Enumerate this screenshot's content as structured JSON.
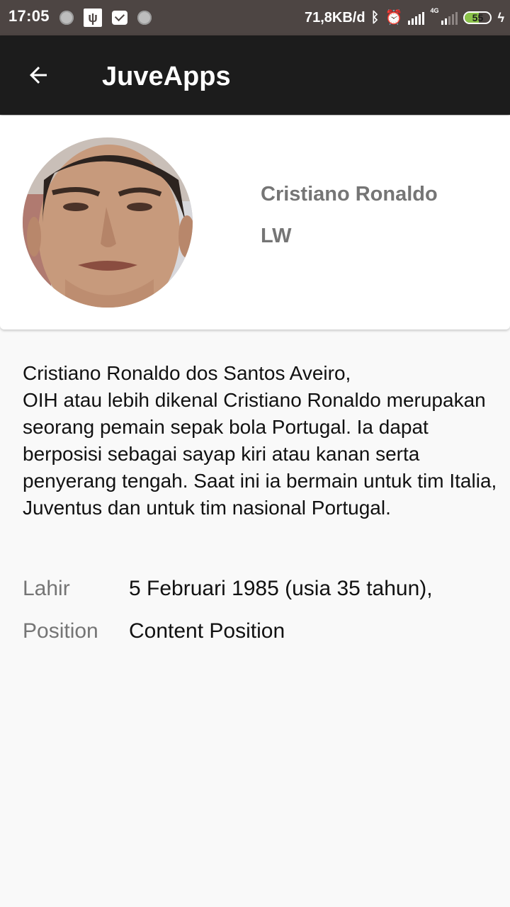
{
  "status_bar": {
    "time": "17:05",
    "net_speed": "71,8KB/d",
    "network_type": "4G",
    "battery_level": "55",
    "battery_fraction": 0.55,
    "icons": [
      "notification-dot-icon",
      "usb-icon",
      "mail-icon",
      "notification-dot-icon",
      "bluetooth-icon",
      "alarm-icon",
      "signal-icon",
      "signal-4g-icon",
      "battery-icon",
      "charging-bolt-icon"
    ]
  },
  "app_bar": {
    "back_icon": "arrow-back-icon",
    "title": "JuveApps"
  },
  "player": {
    "name": "Cristiano Ronaldo",
    "position": "LW",
    "bio": "Cristiano Ronaldo dos Santos Aveiro,\nOIH atau lebih dikenal Cristiano Ronaldo merupakan seorang pemain sepak bola Portugal. Ia dapat berposisi sebagai sayap kiri atau kanan serta penyerang tengah. Saat ini ia bermain untuk tim Italia, Juventus dan untuk tim nasional Portugal."
  },
  "details": {
    "born_label": "Lahir",
    "born_value": "5 Februari 1985 (usia 35 tahun),",
    "position_label": "Position",
    "position_value": "Content Position"
  },
  "colors": {
    "status_bar_bg": "#4d4543",
    "app_bar_bg": "#1c1c1c",
    "page_bg": "#f9f9f9",
    "muted_text": "#757575",
    "battery_fill": "#8bc34a"
  }
}
